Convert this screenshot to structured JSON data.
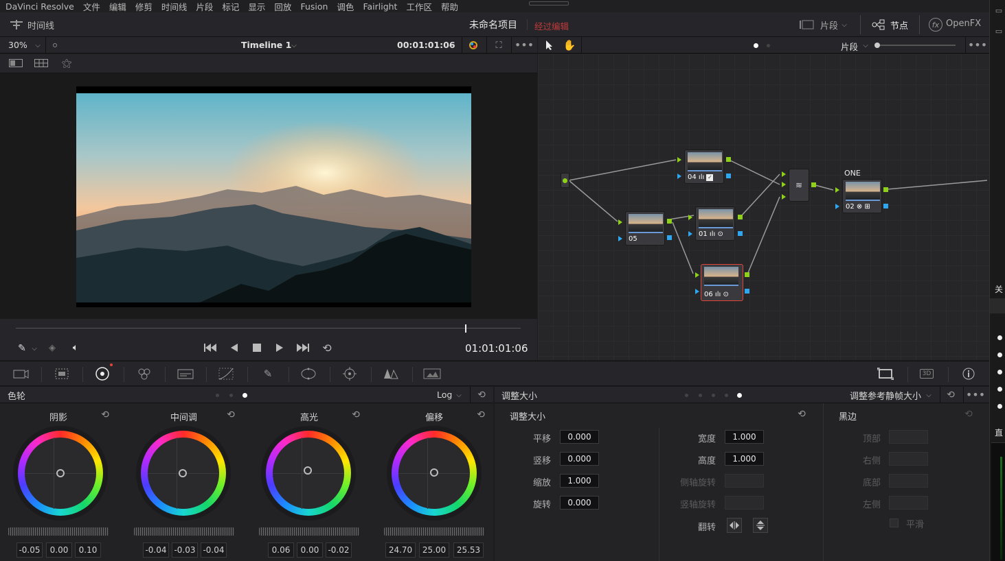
{
  "menubar": {
    "app": "DaVinci Resolve",
    "items": [
      "文件",
      "编辑",
      "修剪",
      "时间线",
      "片段",
      "标记",
      "显示",
      "回放",
      "Fusion",
      "调色",
      "Fairlight",
      "工作区",
      "帮助"
    ]
  },
  "toolbar": {
    "timeline_btn": "时间线",
    "project_name": "未命名项目",
    "project_status": "经过编辑",
    "clips_btn": "片段",
    "nodes_btn": "节点",
    "openfx_btn": "OpenFX"
  },
  "viewer_header": {
    "zoom": "30%",
    "timeline_name": "Timeline 1",
    "timecode": "00:01:01:06"
  },
  "node_header": {
    "mode": "片段"
  },
  "transport": {
    "timecode": "01:01:01:06"
  },
  "nodes": {
    "n04": "04",
    "n05": "05",
    "n01": "01",
    "n06": "06",
    "n02": "02",
    "n02_label": "ONE"
  },
  "wheels_panel": {
    "title": "色轮",
    "mode": "Log",
    "wheels": [
      {
        "name": "阴影",
        "values": [
          "-0.05",
          "0.00",
          "0.10"
        ]
      },
      {
        "name": "中间调",
        "values": [
          "-0.04",
          "-0.03",
          "-0.04"
        ]
      },
      {
        "name": "高光",
        "values": [
          "0.06",
          "0.00",
          "-0.02"
        ]
      },
      {
        "name": "偏移",
        "values": [
          "24.70",
          "25.00",
          "25.53"
        ]
      }
    ]
  },
  "sizing_panel": {
    "header_title": "调整大小",
    "preset": "调整参考静帧大小",
    "section_title": "调整大小",
    "fields": [
      {
        "label": "平移",
        "value": "0.000"
      },
      {
        "label": "竖移",
        "value": "0.000"
      },
      {
        "label": "缩放",
        "value": "1.000"
      },
      {
        "label": "旋转",
        "value": "0.000"
      }
    ],
    "fields2": [
      {
        "label": "宽度",
        "value": "1.000"
      },
      {
        "label": "高度",
        "value": "1.000"
      },
      {
        "label": "侧轴旋转",
        "value": ""
      },
      {
        "label": "竖轴旋转",
        "value": ""
      }
    ],
    "flip_label": "翻转",
    "blanking": {
      "title": "黑边",
      "fields": [
        "顶部",
        "右侧",
        "底部",
        "左侧"
      ],
      "smooth": "平滑"
    }
  },
  "right_strip": {
    "close_label": "关",
    "straight_label": "直"
  }
}
